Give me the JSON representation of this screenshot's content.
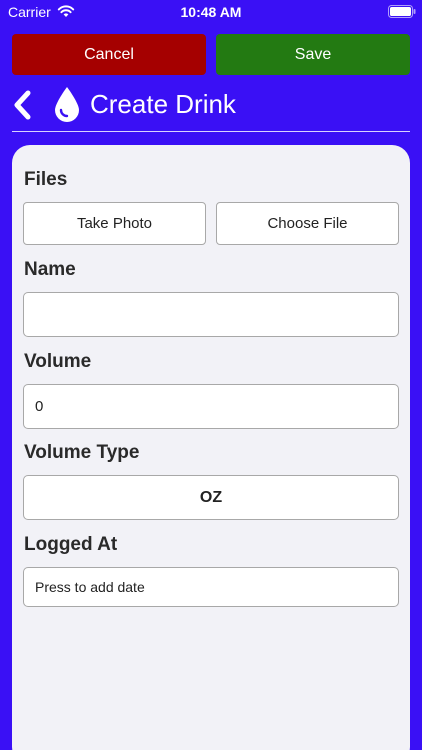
{
  "status_bar": {
    "carrier": "Carrier",
    "time": "10:48 AM",
    "wifi_icon": "wifi-icon",
    "battery_icon": "battery-icon"
  },
  "actions": {
    "cancel_label": "Cancel",
    "save_label": "Save"
  },
  "header": {
    "back_icon": "chevron-left-icon",
    "title_icon": "water-drop-icon",
    "title": "Create Drink"
  },
  "form": {
    "files": {
      "label": "Files",
      "take_photo_label": "Take Photo",
      "choose_file_label": "Choose File"
    },
    "name": {
      "label": "Name",
      "value": ""
    },
    "volume": {
      "label": "Volume",
      "value": "0"
    },
    "volume_type": {
      "label": "Volume Type",
      "selected": "OZ"
    },
    "logged_at": {
      "label": "Logged At",
      "placeholder": "Press to add date"
    }
  },
  "colors": {
    "background": "#3a10f5",
    "cancel": "#a50000",
    "save": "#237a12",
    "card": "#f2f2f7"
  }
}
